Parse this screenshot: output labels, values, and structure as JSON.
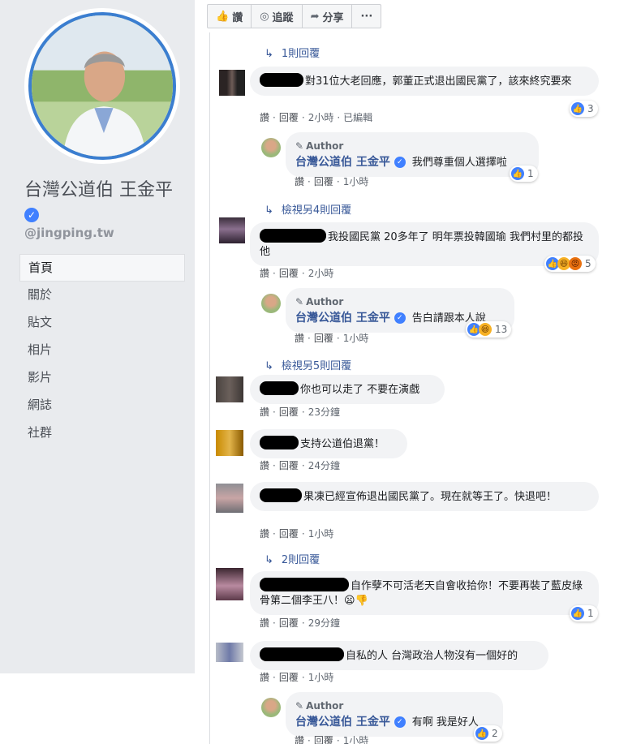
{
  "sidebar": {
    "page_name": "台灣公道伯 王金平",
    "handle": "@jingping.tw",
    "nav": [
      "首頁",
      "關於",
      "貼文",
      "相片",
      "影片",
      "網誌",
      "社群"
    ]
  },
  "actions": {
    "like": "讚",
    "follow": "追蹤",
    "share": "分享",
    "more": "···"
  },
  "labels": {
    "like": "讚",
    "reply": "回覆",
    "author": "Author"
  },
  "comments": [
    {
      "text": "對31位大老回應，郭董正式退出國民黨了，該來終究要來",
      "time": "2小時",
      "edited": "已編輯",
      "reactions": "3",
      "toggle": "1則回覆"
    },
    {
      "author_reply": "我們尊重個人選擇啦",
      "time": "1小時",
      "reactions": "1"
    },
    {
      "text": "我投國民黨 20多年了 明年票投韓國瑜 我們村里的都投他",
      "time": "2小時",
      "reactions": "5",
      "toggle": "檢視另4則回覆"
    },
    {
      "author_reply": "告白請跟本人說",
      "time": "1小時",
      "reactions": "13"
    },
    {
      "text": "你也可以走了 不要在演戲",
      "time": "23分鐘",
      "toggle": "檢視另5則回覆"
    },
    {
      "text": "支持公道伯退黨！",
      "time": "24分鐘"
    },
    {
      "text": "果凍已經宣佈退出國民黨了。現在就等王了。快退吧！",
      "time": "1小時"
    },
    {
      "text": "自作孽不可活老天自會收拾你！不要再裝了藍皮綠骨第二個李王八！😦👎",
      "time": "29分鐘",
      "reactions": "1",
      "toggle": "2則回覆"
    },
    {
      "text": "自私的人 台灣政治人物沒有一個好的",
      "time": "1小時"
    },
    {
      "author_reply": "有啊 我是好人",
      "time": "1小時",
      "reactions": "2"
    }
  ],
  "colors": {
    "link": "#385898",
    "like_blue": "#4080ff",
    "sidebar_bg": "#e9ebee",
    "bubble_bg": "#f2f3f5"
  }
}
